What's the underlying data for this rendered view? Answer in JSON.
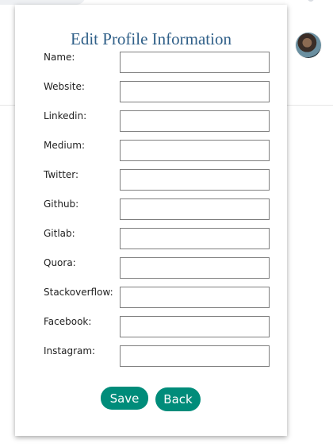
{
  "modal": {
    "title": "Edit Profile Information",
    "fields": [
      {
        "label": "Name:",
        "value": "",
        "placeholder": ""
      },
      {
        "label": "Website:",
        "value": "",
        "placeholder": ""
      },
      {
        "label": "Linkedin:",
        "value": "",
        "placeholder": ""
      },
      {
        "label": "Medium:",
        "value": "",
        "placeholder": ""
      },
      {
        "label": "Twitter:",
        "value": "",
        "placeholder": ""
      },
      {
        "label": "Github:",
        "value": "",
        "placeholder": ""
      },
      {
        "label": "Gitlab:",
        "value": "",
        "placeholder": ""
      },
      {
        "label": "Quora:",
        "value": "",
        "placeholder": ""
      },
      {
        "label": "Stackoverflow:",
        "value": "",
        "placeholder": ""
      },
      {
        "label": "Facebook:",
        "value": "",
        "placeholder": ""
      },
      {
        "label": "Instagram:",
        "value": "",
        "placeholder": ""
      }
    ],
    "buttons": {
      "save_label": "Save",
      "back_label": "Back"
    }
  },
  "colors": {
    "title": "#2f5f88",
    "button_bg": "#008c7a",
    "button_text": "#ffffff"
  },
  "icons": {
    "avatar": "profile-avatar"
  }
}
